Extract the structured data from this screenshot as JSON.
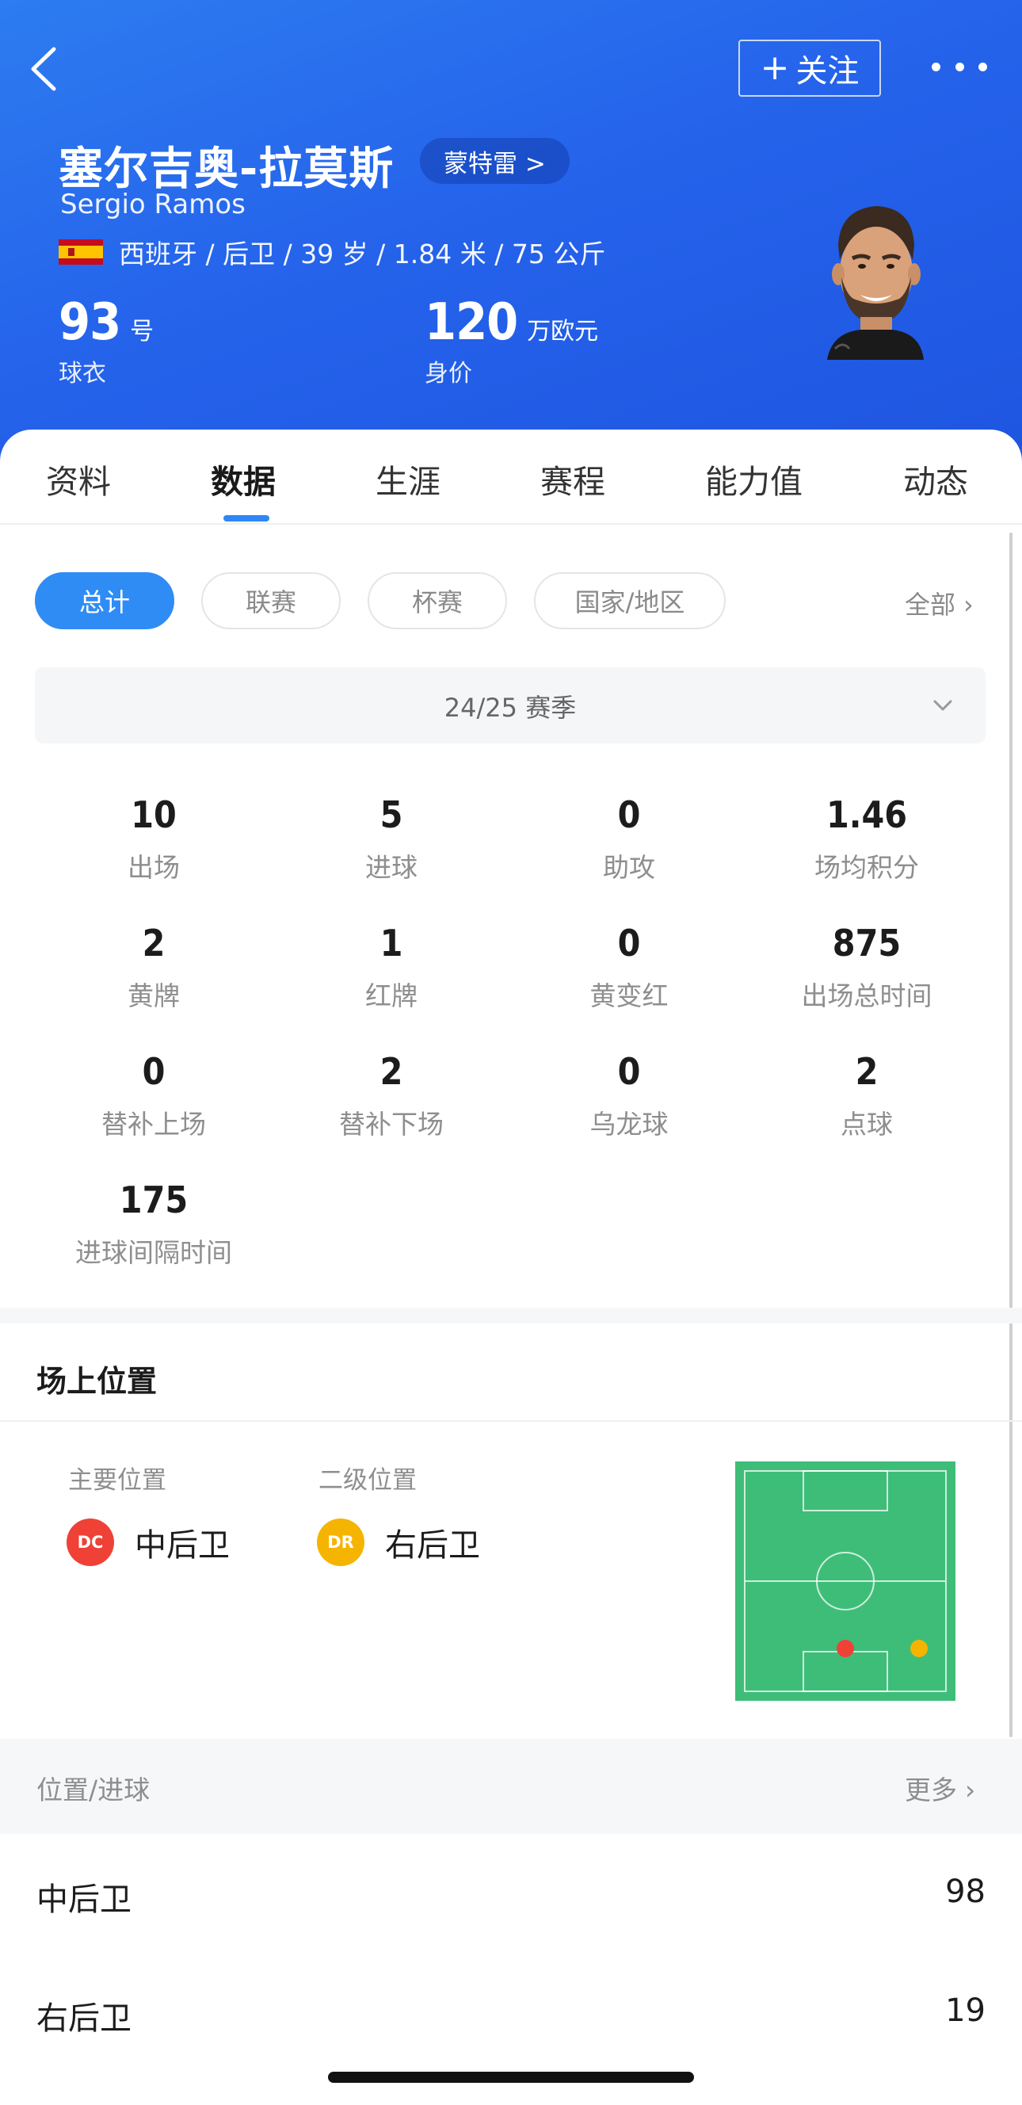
{
  "header": {
    "name_cn": "塞尔吉奥-拉莫斯",
    "club": "蒙特雷 >",
    "name_en": "Sergio Ramos",
    "info": "西班牙 / 后卫 / 39 岁 / 1.84 米 / 75 公斤",
    "follow_label": "关注",
    "jersey_number": "93",
    "jersey_unit": "号",
    "jersey_label": "球衣",
    "market_value": "120",
    "market_value_unit": "万欧元",
    "market_value_label": "身价",
    "flag": "spain-flag",
    "colors": {
      "background": "#2563eb"
    }
  },
  "tabs": [
    "资料",
    "数据",
    "生涯",
    "赛程",
    "能力值",
    "动态"
  ],
  "active_tab": "数据",
  "filters": [
    "总计",
    "联赛",
    "杯赛",
    "国家/地区"
  ],
  "active_filter": "总计",
  "all_link": "全部",
  "season": "24/25 赛季",
  "stats": [
    {
      "value": "10",
      "label": "出场"
    },
    {
      "value": "5",
      "label": "进球"
    },
    {
      "value": "0",
      "label": "助攻"
    },
    {
      "value": "1.46",
      "label": "场均积分"
    },
    {
      "value": "2",
      "label": "黄牌"
    },
    {
      "value": "1",
      "label": "红牌"
    },
    {
      "value": "0",
      "label": "黄变红"
    },
    {
      "value": "875",
      "label": "出场总时间"
    },
    {
      "value": "0",
      "label": "替补上场"
    },
    {
      "value": "2",
      "label": "替补下场"
    },
    {
      "value": "0",
      "label": "乌龙球"
    },
    {
      "value": "2",
      "label": "点球"
    },
    {
      "value": "175",
      "label": "进球间隔时间"
    }
  ],
  "positions": {
    "title": "场上位置",
    "primary_label": "主要位置",
    "primary": {
      "code": "DC",
      "name": "中后卫",
      "color": "#ef4136"
    },
    "secondary_label": "二级位置",
    "secondary": {
      "code": "DR",
      "name": "右后卫",
      "color": "#f5b400"
    },
    "pitch_color": "#3ebd78"
  },
  "position_goals": {
    "title": "位置/进球",
    "more": "更多",
    "rows": [
      {
        "name": "中后卫",
        "count": "98"
      },
      {
        "name": "右后卫",
        "count": "19"
      }
    ]
  }
}
